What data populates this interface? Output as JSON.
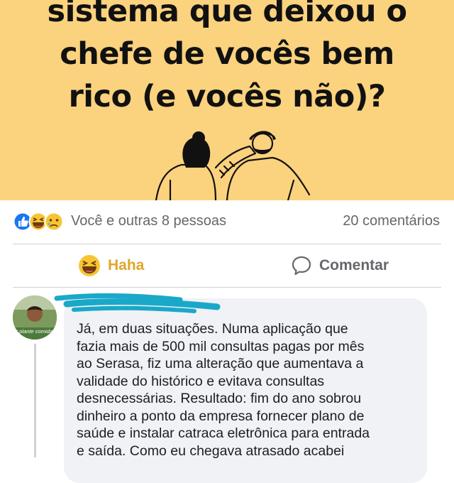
{
  "banner": {
    "headline_lines": [
      "sistema que deixou o",
      "chefe de vocês bem",
      "rico (e vocês não)?"
    ],
    "background_color": "#fbd27e"
  },
  "reactions": {
    "icons": [
      "like-icon",
      "haha-icon",
      "sad-icon"
    ],
    "summary": "Você e outras 8 pessoas",
    "comment_count": "20 comentários"
  },
  "actions": {
    "haha_label": "Haha",
    "comment_label": "Comentar"
  },
  "comment": {
    "author": "",
    "avatar_badge": "# plante comida",
    "text_lines": [
      "Já, em duas situações. Numa aplicação que",
      "fazia mais de 500 mil consultas pagas por mês",
      "ao Serasa, fiz uma alteração que aumentava a",
      "validade do histórico e evitava consultas",
      "desnecessárias. Resultado: fim do ano sobrou",
      "dinheiro a ponto da empresa fornecer plano de",
      "saúde e instalar catraca eletrônica para entrada",
      "e saída. Como eu chegava atrasado acabei"
    ]
  },
  "colors": {
    "haha_accent": "#e0a52b",
    "secondary_text": "#65676b",
    "bubble_bg": "#f0f2f5",
    "scribble": "#1aa8c9"
  }
}
